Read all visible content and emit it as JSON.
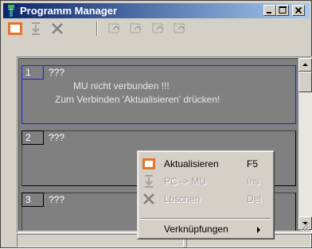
{
  "window": {
    "title": "Programm Manager",
    "controls": {
      "minimize": "minimize-icon",
      "maximize": "maximize-icon",
      "close": "close-icon"
    }
  },
  "toolbar": {
    "buttons": [
      {
        "name": "refresh",
        "icon": "refresh-icon",
        "enabled": true
      },
      {
        "name": "transfer",
        "icon": "transfer-icon",
        "enabled": false
      },
      {
        "name": "delete",
        "icon": "delete-icon",
        "enabled": false
      },
      {
        "name": "link-1",
        "icon": "link-icon",
        "enabled": false
      },
      {
        "name": "link-2",
        "icon": "link-icon",
        "enabled": false
      },
      {
        "name": "link-3",
        "icon": "link-icon",
        "enabled": false
      },
      {
        "name": "link-4",
        "icon": "link-icon",
        "enabled": false
      }
    ]
  },
  "items": [
    {
      "number": "1",
      "name": "???",
      "line1": "MU nicht verbunden !!!",
      "line2": "Zum Verbinden 'Aktualisieren' drücken!",
      "selected": true
    },
    {
      "number": "2",
      "name": "???"
    },
    {
      "number": "3",
      "name": "???"
    }
  ],
  "context_menu": {
    "items": [
      {
        "label": "Aktualisieren",
        "shortcut": "F5",
        "icon": "refresh-icon",
        "enabled": true
      },
      {
        "label": "PC -> MU",
        "shortcut": "Ins",
        "icon": "transfer-icon",
        "enabled": false
      },
      {
        "label": "Löschen",
        "shortcut": "Del",
        "icon": "delete-icon",
        "enabled": false
      },
      {
        "label": "Verknüpfungen",
        "shortcut": "",
        "submenu": true,
        "enabled": true
      }
    ]
  },
  "colors": {
    "titlebar_start": "#0a246a",
    "titlebar_end": "#a6caf0",
    "selection_border": "#1a1aff",
    "list_background": "#808080",
    "refresh_icon_orange": "#e8742a"
  }
}
